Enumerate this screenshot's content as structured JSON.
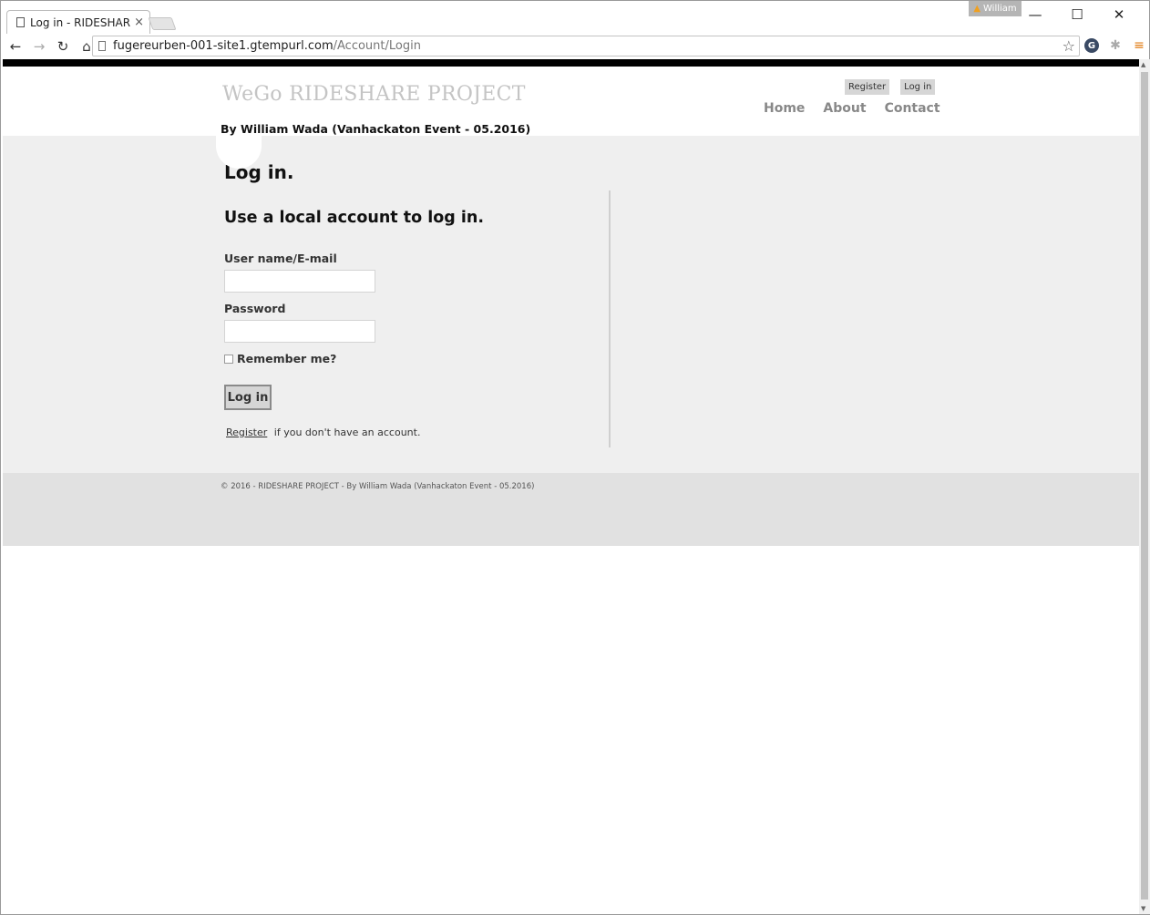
{
  "browser": {
    "tab_title": "Log in - RIDESHARE",
    "tab_close": "×",
    "profile_name": "William",
    "url_host": "fugereurben-001-site1.gtempurl.com",
    "url_path": "/Account/Login",
    "icons": {
      "back": "←",
      "forward": "→",
      "reload": "↻",
      "home": "⌂",
      "star": "☆",
      "menu": "≡",
      "minimize": "—",
      "maximize": "☐",
      "close": "✕"
    }
  },
  "site": {
    "title": "WeGo RIDESHARE PROJECT",
    "subtitle": "By William Wada (Vanhackaton Event - 05.2016)",
    "account_links": {
      "register": "Register",
      "login": "Log in"
    },
    "nav": {
      "home": "Home",
      "about": "About",
      "contact": "Contact"
    }
  },
  "login": {
    "page_title": "Log in.",
    "section_title": "Use a local account to log in.",
    "username_label": "User name/E-mail",
    "username_value": "",
    "password_label": "Password",
    "password_value": "",
    "remember_label": "Remember me?",
    "remember_checked": false,
    "submit_label": "Log in",
    "register_link": "Register",
    "register_suffix": "if you don't have an account."
  },
  "footer": {
    "text": "© 2016 - RIDESHARE PROJECT - By William Wada (Vanhackaton Event - 05.2016)"
  },
  "colors": {
    "body_band": "#efefef",
    "footer": "#e1e1e1",
    "title_gray": "#c4c4c4",
    "black_bar": "#000000"
  }
}
